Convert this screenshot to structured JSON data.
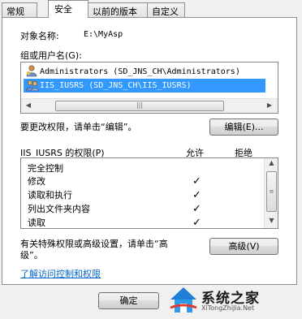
{
  "tabs": [
    {
      "label": "常规"
    },
    {
      "label": "安全"
    },
    {
      "label": "以前的版本"
    },
    {
      "label": "自定义"
    }
  ],
  "object": {
    "label": "对象名称:",
    "value": "E:\\MyAsp"
  },
  "groups": {
    "label": "组或用户名(G):",
    "items": [
      {
        "name": "Administrators (SD_JNS_CH\\Administrators)",
        "icon": "admin-user-icon"
      },
      {
        "name": "IIS_IUSRS (SD_JNS_CH\\IIS_IUSRS)",
        "icon": "users-group-icon",
        "selected": true
      }
    ]
  },
  "change_hint": "要更改权限，请单击“编辑”。",
  "edit_button": {
    "label": "编辑",
    "hotkey": "(E)..."
  },
  "permissions": {
    "header": "IIS_IUSRS 的权限(P)",
    "allow": "允许",
    "deny": "拒绝",
    "rows": [
      {
        "name": "完全控制",
        "allow": "",
        "deny": ""
      },
      {
        "name": "修改",
        "allow": "✓",
        "deny": ""
      },
      {
        "name": "读取和执行",
        "allow": "✓",
        "deny": ""
      },
      {
        "name": "列出文件夹内容",
        "allow": "✓",
        "deny": ""
      },
      {
        "name": "读取",
        "allow": "✓",
        "deny": ""
      }
    ]
  },
  "special_hint_line1": "有关特殊权限或高级设置，请单击“高",
  "special_hint_line2": "级”。",
  "advanced_button": {
    "label": "高级",
    "hotkey": "(V)"
  },
  "link": "了解访问控制和权限",
  "ok_button": "确定",
  "watermark": {
    "brand": "系统之家",
    "url": "XiTongZhiJia.Net"
  },
  "colors": {
    "selection": "#3399ff",
    "link": "#0066cc"
  }
}
